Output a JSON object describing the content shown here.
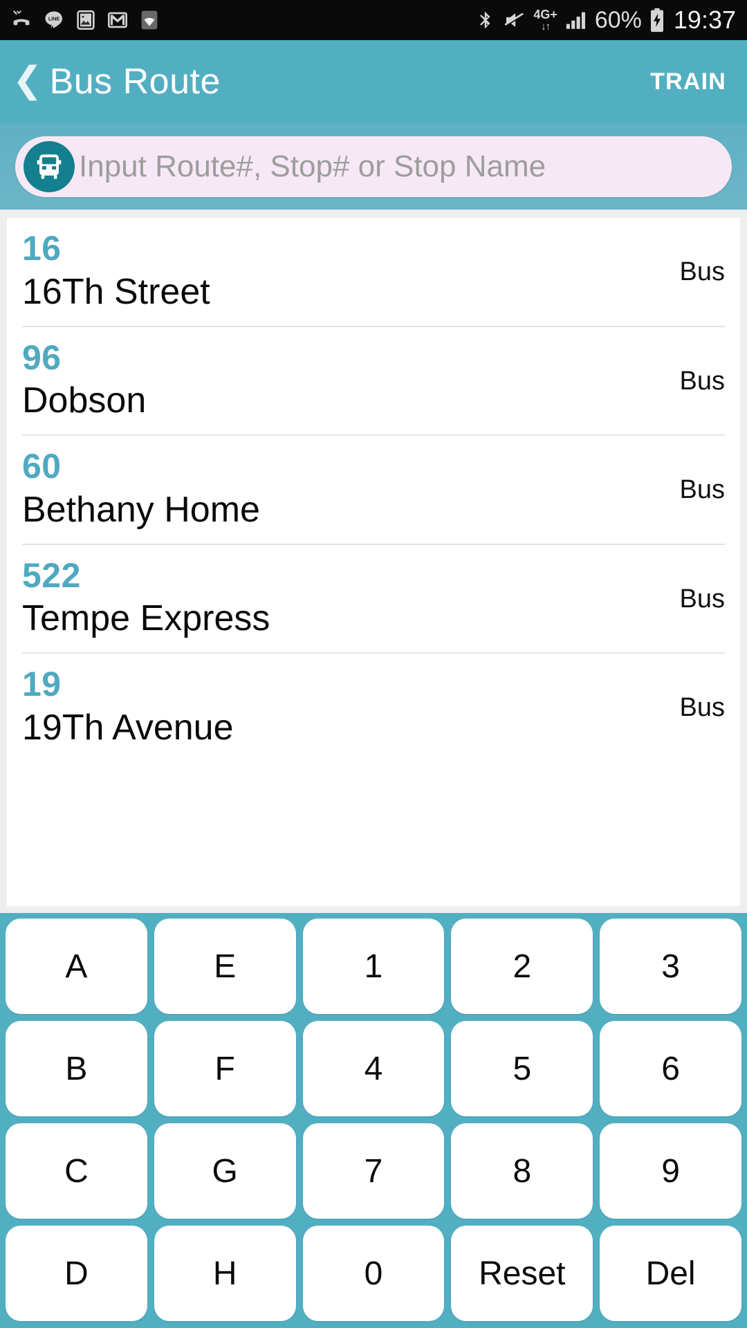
{
  "status_bar": {
    "left_icons": [
      "missed-call-icon",
      "line-app-icon",
      "gallery-icon",
      "gmail-icon",
      "wifi-icon"
    ],
    "bluetooth_icon": "bluetooth-icon",
    "mute_icon": "volume-mute-icon",
    "network_label": "4G+",
    "network_arrows": "↓↑",
    "signal_icon": "signal-bars-icon",
    "battery_percent": "60%",
    "battery_icon": "battery-charging-icon",
    "time": "19:37"
  },
  "header": {
    "back_icon": "❮",
    "title": "Bus Route",
    "action_label": "TRAIN"
  },
  "search": {
    "icon": "bus-icon",
    "placeholder": "Input Route#, Stop# or Stop Name",
    "value": ""
  },
  "results": [
    {
      "number": "16",
      "name": "16Th Street",
      "type": "Bus"
    },
    {
      "number": "96",
      "name": "Dobson",
      "type": "Bus"
    },
    {
      "number": "60",
      "name": "Bethany Home",
      "type": "Bus"
    },
    {
      "number": "522",
      "name": "Tempe Express",
      "type": "Bus"
    },
    {
      "number": "19",
      "name": "19Th Avenue",
      "type": "Bus"
    }
  ],
  "keypad": {
    "rows": [
      [
        "A",
        "E",
        "1",
        "2",
        "3"
      ],
      [
        "B",
        "F",
        "4",
        "5",
        "6"
      ],
      [
        "C",
        "G",
        "7",
        "8",
        "9"
      ],
      [
        "D",
        "H",
        "0",
        "Reset",
        "Del"
      ]
    ]
  },
  "colors": {
    "accent_teal": "#52afc2",
    "route_number_teal": "#4fa9c0",
    "search_field_bg": "#f7e8f6",
    "bus_badge_bg": "#14808f",
    "page_bg": "#eeeeee"
  }
}
